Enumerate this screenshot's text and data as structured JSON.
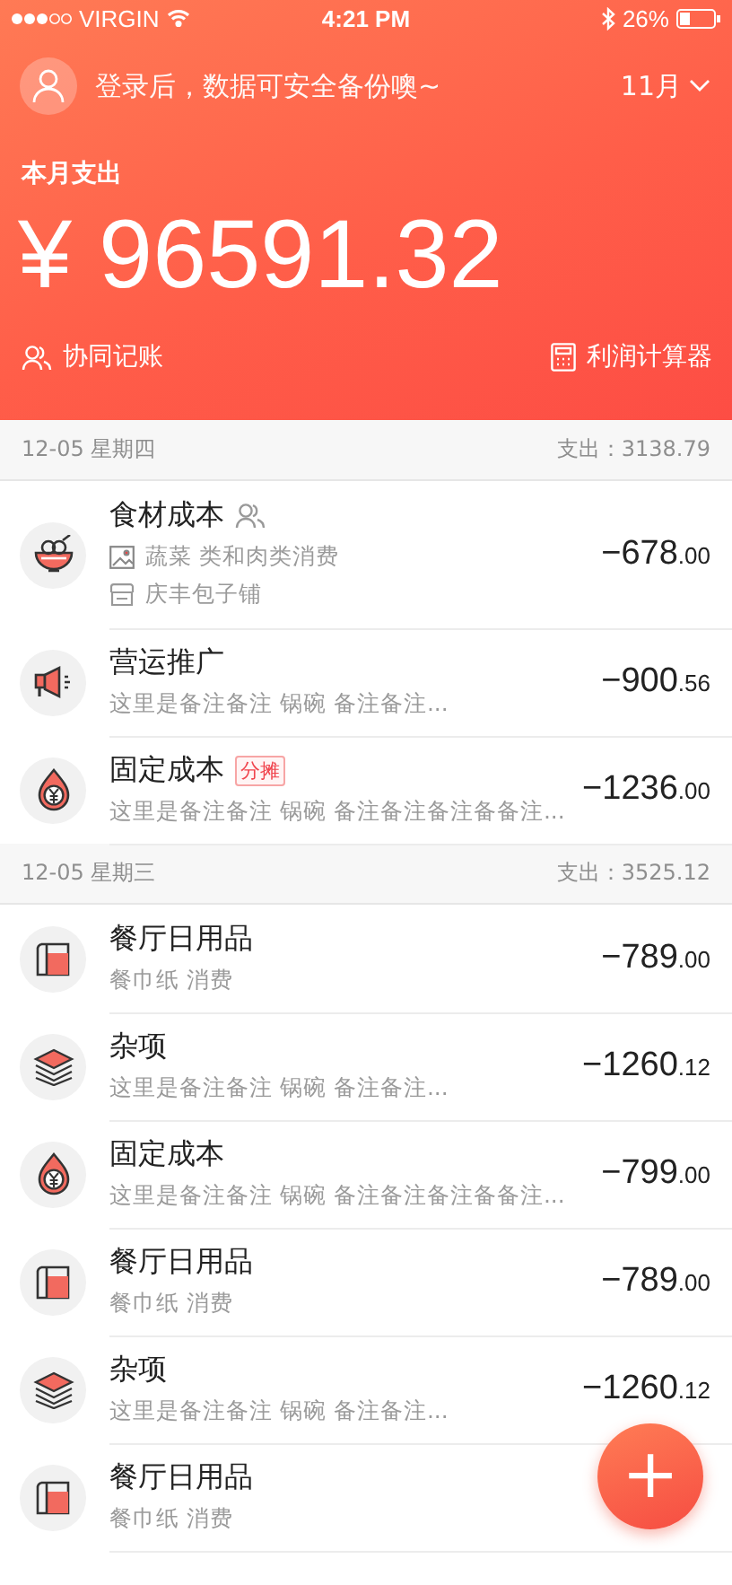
{
  "status_bar": {
    "carrier": "VIRGIN",
    "time": "4:21 PM",
    "battery": "26%"
  },
  "header": {
    "login_prompt": "登录后，数据可安全备份噢~",
    "month": "11月",
    "label": "本月支出",
    "total": "¥ 96591.32",
    "collab": "协同记账",
    "calculator": "利润计算器"
  },
  "groups": [
    {
      "date": "12-05 星期四",
      "summary": "支出：3138.79",
      "rows": [
        {
          "kind": "bowl",
          "title": "食材成本",
          "shared": true,
          "photo": true,
          "note": "蔬菜 类和肉类消费",
          "shop": "庆丰包子铺",
          "amount": "−678",
          "cents": ".00"
        },
        {
          "kind": "megaphone",
          "title": "营运推广",
          "shared": false,
          "photo": false,
          "note": "这里是备注备注 锅碗 备注备注...",
          "amount": "−900",
          "cents": ".56"
        },
        {
          "kind": "drop",
          "title": "固定成本",
          "shared": false,
          "photo": false,
          "tag": "分摊",
          "note": "这里是备注备注 锅碗 备注备注备注备备注...",
          "amount": "−1236",
          "cents": ".00"
        }
      ]
    },
    {
      "date": "12-05 星期三",
      "summary": "支出：3525.12",
      "rows": [
        {
          "kind": "roll",
          "title": "餐厅日用品",
          "shared": false,
          "photo": false,
          "note": "餐巾纸 消费",
          "amount": "−789",
          "cents": ".00"
        },
        {
          "kind": "layers",
          "title": "杂项",
          "shared": false,
          "photo": false,
          "note": "这里是备注备注 锅碗 备注备注...",
          "amount": "−1260",
          "cents": ".12"
        },
        {
          "kind": "drop",
          "title": "固定成本",
          "shared": false,
          "photo": false,
          "note": "这里是备注备注 锅碗 备注备注备注备备注...",
          "amount": "−799",
          "cents": ".00"
        },
        {
          "kind": "roll",
          "title": "餐厅日用品",
          "shared": false,
          "photo": false,
          "note": "餐巾纸 消费",
          "amount": "−789",
          "cents": ".00"
        },
        {
          "kind": "layers",
          "title": "杂项",
          "shared": false,
          "photo": false,
          "note": "这里是备注备注 锅碗 备注备注...",
          "amount": "−1260",
          "cents": ".12"
        },
        {
          "kind": "roll",
          "title": "餐厅日用品",
          "shared": false,
          "photo": false,
          "note": "餐巾纸 消费"
        }
      ]
    }
  ],
  "fab": {
    "label": "+"
  }
}
